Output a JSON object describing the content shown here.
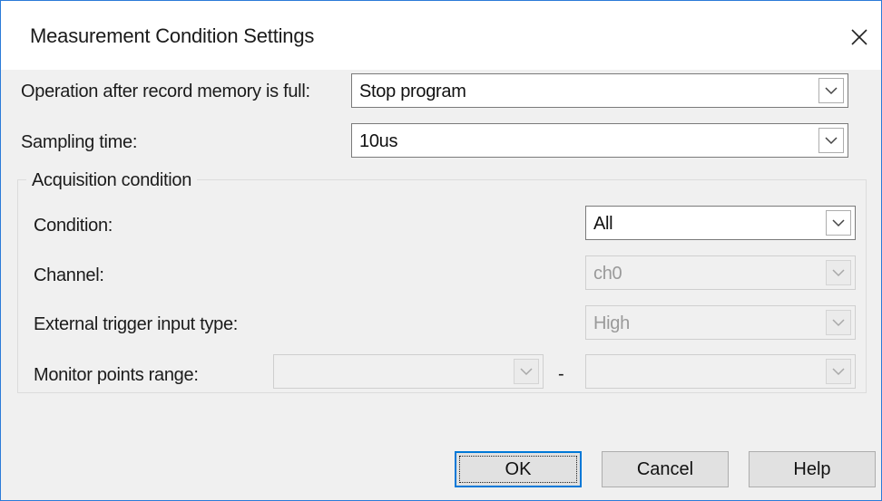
{
  "window": {
    "title": "Measurement Condition Settings"
  },
  "fields": {
    "operation_label": "Operation after record memory is full:",
    "operation_value": "Stop program",
    "sampling_label": "Sampling time:",
    "sampling_value": "10us"
  },
  "acquisition": {
    "group_label": "Acquisition condition",
    "condition_label": "Condition:",
    "condition_value": "All",
    "channel_label": "Channel:",
    "channel_value": "ch0",
    "trigger_label": "External trigger input type:",
    "trigger_value": "High",
    "range_label": "Monitor points range:",
    "range_from_value": "",
    "range_separator": "-",
    "range_to_value": ""
  },
  "buttons": {
    "ok": "OK",
    "cancel": "Cancel",
    "help": "Help"
  },
  "icons": {
    "close": "close-icon",
    "dropdown": "chevron-down-icon"
  },
  "colors": {
    "accent": "#0078d7",
    "window_border": "#2b7bd8",
    "client_bg": "#f0f0f0"
  }
}
